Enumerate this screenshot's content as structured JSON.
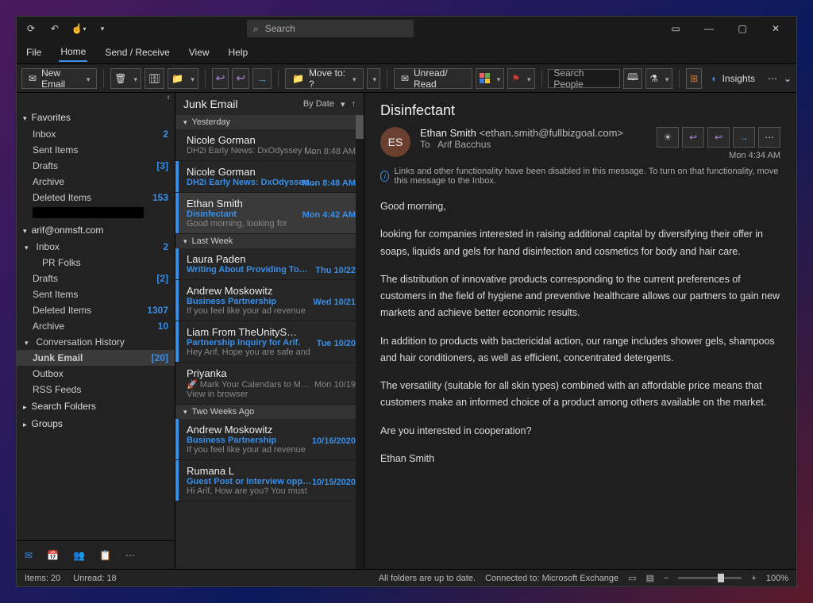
{
  "titlebar": {
    "search_placeholder": "Search"
  },
  "menubar": {
    "file": "File",
    "home": "Home",
    "send_receive": "Send / Receive",
    "view": "View",
    "help": "Help"
  },
  "ribbon": {
    "new_email": "New Email",
    "move_to": "Move to: ?",
    "unread_read": "Unread/ Read",
    "search_people_placeholder": "Search People",
    "insights": "Insights"
  },
  "sidebar": {
    "favorites_label": "Favorites",
    "favorites": [
      {
        "label": "Inbox",
        "count": "2"
      },
      {
        "label": "Sent Items",
        "count": ""
      },
      {
        "label": "Drafts",
        "count": "[3]"
      },
      {
        "label": "Archive",
        "count": ""
      },
      {
        "label": "Deleted Items",
        "count": "153"
      }
    ],
    "account_label": "arif@onmsft.com",
    "account_folders": [
      {
        "label": "Inbox",
        "count": "2",
        "sub": [
          {
            "label": "PR Folks",
            "count": ""
          }
        ]
      },
      {
        "label": "Drafts",
        "count": "[2]"
      },
      {
        "label": "Sent Items",
        "count": ""
      },
      {
        "label": "Deleted Items",
        "count": "1307"
      },
      {
        "label": "Archive",
        "count": "10"
      },
      {
        "label": "Conversation History",
        "count": "",
        "expandable": true
      },
      {
        "label": "Junk Email",
        "count": "[20]",
        "selected": true
      },
      {
        "label": "Outbox",
        "count": ""
      },
      {
        "label": "RSS Feeds",
        "count": ""
      }
    ],
    "search_folders": "Search Folders",
    "groups": "Groups"
  },
  "maillist": {
    "title": "Junk Email",
    "sort_label": "By Date",
    "groups": [
      {
        "label": "Yesterday",
        "items": [
          {
            "from": "Nicole Gorman",
            "subject": "DH2i Early News: DxOdyssey f…",
            "date": "Mon 8:48 AM",
            "unread": false,
            "preview": ""
          },
          {
            "from": "Nicole Gorman",
            "subject": "DH2i Early News: DxOdyssee…",
            "date": "Mon 8:48 AM",
            "unread": true,
            "preview": ""
          },
          {
            "from": "Ethan Smith",
            "subject": "Disinfectant",
            "date": "Mon 4:42 AM",
            "unread": true,
            "selected": true,
            "preview": "Good morning,  looking for"
          }
        ]
      },
      {
        "label": "Last Week",
        "items": [
          {
            "from": "Laura Paden",
            "subject": "Writing About Providing To…",
            "date": "Thu 10/22",
            "unread": true,
            "preview": ""
          },
          {
            "from": "Andrew Moskowitz",
            "subject": "Business Partnership",
            "date": "Wed 10/21",
            "unread": true,
            "preview": "If you feel like your ad revenue"
          },
          {
            "from": "Liam From TheUnityS…",
            "subject": "Partnership Inquiry for Arif.",
            "date": "Tue 10/20",
            "unread": true,
            "preview": "Hey Arif,  Hope you are safe and"
          },
          {
            "from": "Priyanka",
            "subject": "🚀 Mark Your Calendars to M…",
            "date": "Mon 10/19",
            "unread": false,
            "preview": "View in browser"
          }
        ]
      },
      {
        "label": "Two Weeks Ago",
        "items": [
          {
            "from": "Andrew Moskowitz",
            "subject": "Business Partnership",
            "date": "10/16/2020",
            "unread": true,
            "preview": "If you feel like your ad revenue"
          },
          {
            "from": "Rumana L",
            "subject": "Guest Post or Interview opp…",
            "date": "10/15/2020",
            "unread": true,
            "preview": "Hi Arif,  How are you?  You must"
          }
        ]
      }
    ]
  },
  "reading": {
    "subject": "Disinfectant",
    "initials": "ES",
    "from_name": "Ethan Smith",
    "from_email": "<ethan.smith@fullbizgoal.com>",
    "to_label": "To",
    "to_name": "Arif Bacchus",
    "date": "Mon 4:34 AM",
    "info": "Links and other functionality have been disabled in this message. To turn on that functionality, move this message to the Inbox.",
    "body": [
      "Good morning,",
      "looking for companies interested in raising additional capital by diversifying their offer in soaps, liquids and gels for hand disinfection and cosmetics for body and hair care.",
      "The distribution of innovative products corresponding to the current preferences of customers in the field of hygiene and preventive healthcare allows our partners to gain new markets and achieve better economic results.",
      "In addition to products with bactericidal action, our range includes shower gels, shampoos and hair conditioners, as well as efficient, concentrated detergents.",
      "The versatility (suitable for all skin types) combined with an affordable price means that customers make an informed choice of a product among others available on the market.",
      "Are you interested in cooperation?",
      "Ethan Smith"
    ]
  },
  "statusbar": {
    "items": "Items: 20",
    "unread": "Unread: 18",
    "folders": "All folders are up to date.",
    "connected": "Connected to: Microsoft Exchange",
    "zoom": "100%"
  }
}
